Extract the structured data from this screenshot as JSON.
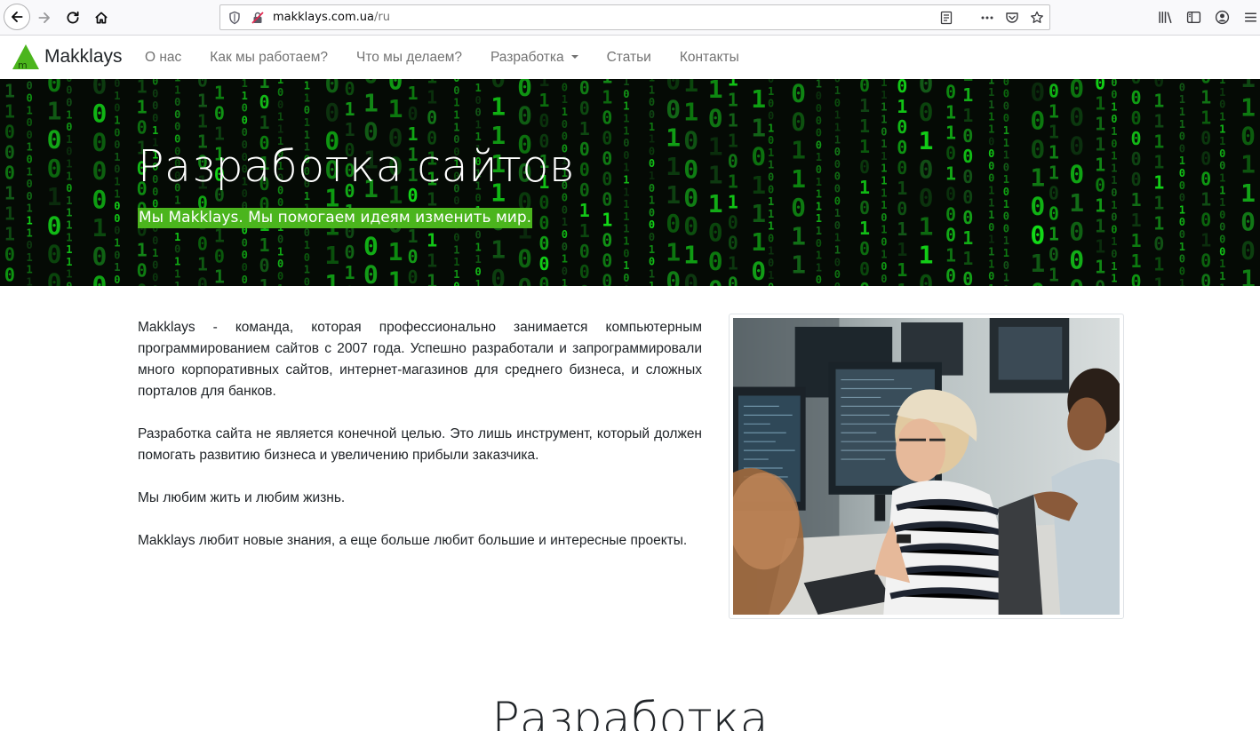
{
  "browser": {
    "url_domain": "makklays.com.ua",
    "url_path": "/ru"
  },
  "site": {
    "brand": "Makklays",
    "logo_letter": "m",
    "nav": [
      {
        "label": "О нас"
      },
      {
        "label": "Как мы работаем?"
      },
      {
        "label": "Что мы делаем?"
      },
      {
        "label": "Разработка",
        "dropdown": true
      },
      {
        "label": "Статьи"
      },
      {
        "label": "Контакты"
      }
    ]
  },
  "hero": {
    "title": "Разработка сайтов",
    "subtitle": "Мы Makklays. Мы помогаем идеям изменить мир.",
    "accent_color": "#4bb51d"
  },
  "content": {
    "paragraphs": [
      "Makklays - команда, которая профессионально занимается компьютерным программированием сайтов с 2007 года. Успешно разработали и запрограммировали много корпоративных сайтов, интернет-магазинов для среднего бизнеса, и сложных порталов для банков.",
      "Разработка сайта не является конечной целью. Это лишь инструмент, который должен помогать развитию бизнеса и увеличению прибыли заказчика.",
      "Мы любим жить и любим жизнь.",
      "Makklays любит новые знания, а еще больше любит большие и интересные проекты."
    ],
    "section_title": "Разработка"
  }
}
